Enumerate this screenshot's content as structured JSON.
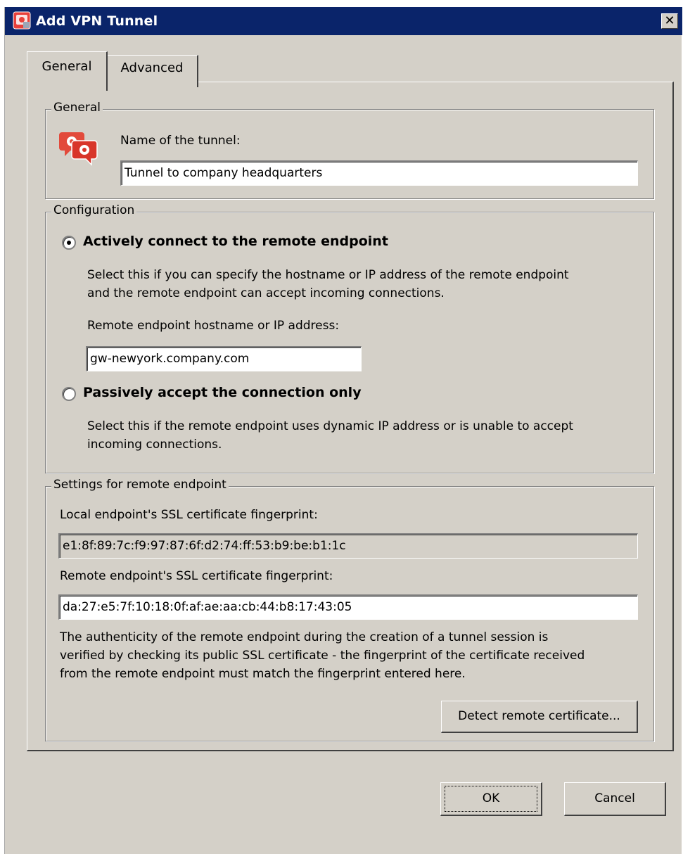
{
  "window": {
    "title": "Add VPN Tunnel",
    "close_symbol": "✕"
  },
  "tabs": [
    {
      "label": "General",
      "selected": true
    },
    {
      "label": "Advanced",
      "selected": false
    }
  ],
  "general_group": {
    "legend": "General",
    "icon": "vpn-tunnel-icon",
    "name_label": "Name of the tunnel:",
    "name_value": "Tunnel to company headquarters"
  },
  "configuration_group": {
    "legend": "Configuration",
    "active_option": {
      "label": "Actively connect to the remote endpoint",
      "selected": true,
      "description_line1": "Select this if you can specify the hostname or IP address of the remote endpoint",
      "description_line2": "and the remote endpoint can accept incoming connections.",
      "hostname_label": "Remote endpoint hostname or IP address:",
      "hostname_value": "gw-newyork.company.com"
    },
    "passive_option": {
      "label": "Passively accept the connection only",
      "selected": false,
      "description_line1": "Select this if the remote endpoint uses dynamic IP address or is unable to accept",
      "description_line2": "incoming connections."
    }
  },
  "remote_settings_group": {
    "legend": "Settings for remote endpoint",
    "local_fp_label": "Local endpoint's SSL certificate fingerprint:",
    "local_fp_value": "e1:8f:89:7c:f9:97:87:6f:d2:74:ff:53:b9:be:b1:1c",
    "remote_fp_label": "Remote endpoint's SSL certificate fingerprint:",
    "remote_fp_value": "da:27:e5:7f:10:18:0f:af:ae:aa:cb:44:b8:17:43:05",
    "info_line1": "The authenticity of the remote endpoint during the creation of a tunnel session is",
    "info_line2": "verified by checking its public SSL certificate - the fingerprint of the certificate received",
    "info_line3": "from the remote endpoint must match the fingerprint entered here.",
    "detect_button": "Detect remote certificate..."
  },
  "footer": {
    "ok_label": "OK",
    "cancel_label": "Cancel"
  }
}
